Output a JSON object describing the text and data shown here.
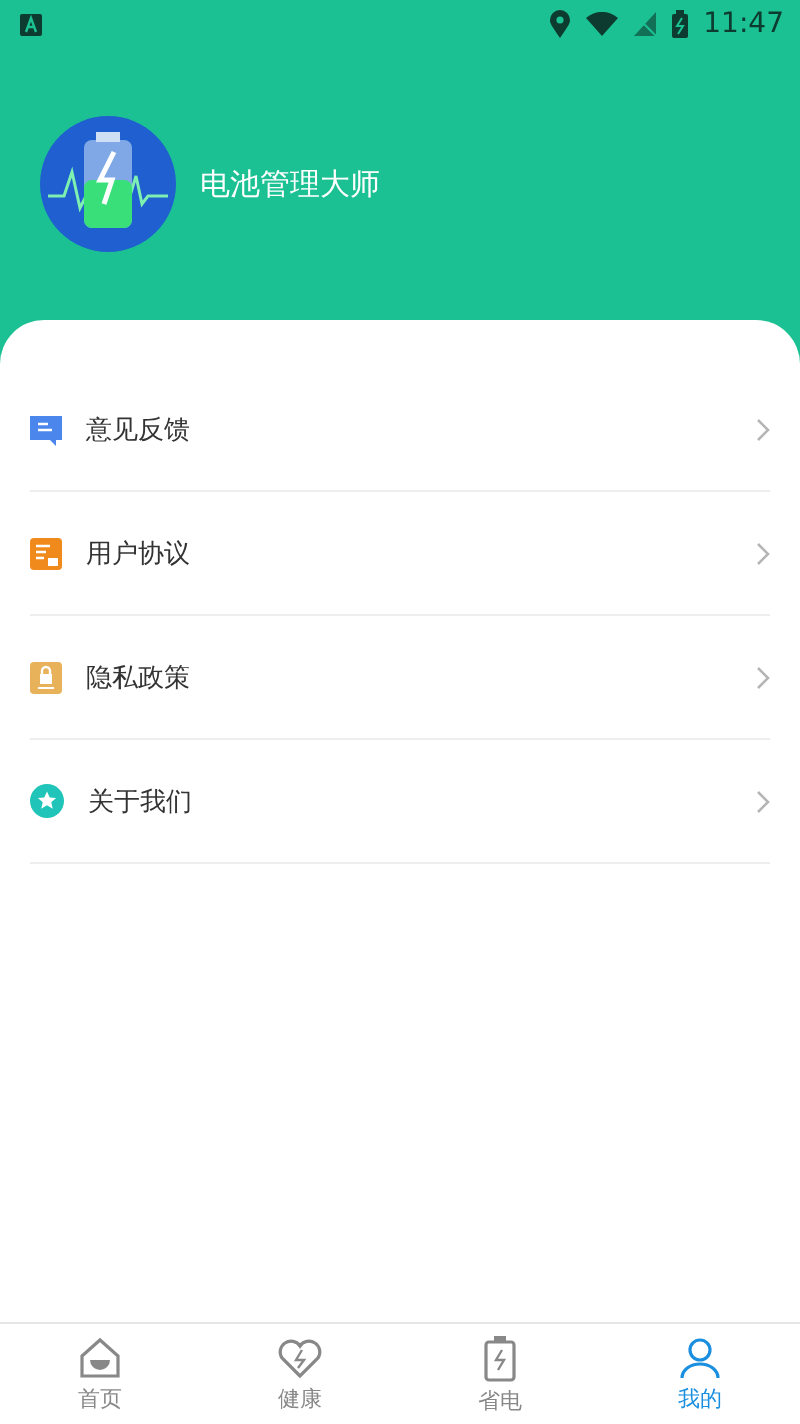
{
  "status_bar": {
    "time": "11:47"
  },
  "profile": {
    "app_name": "电池管理大师"
  },
  "menu": [
    {
      "kind": "feedback",
      "label": "意见反馈"
    },
    {
      "kind": "agreement",
      "label": "用户协议"
    },
    {
      "kind": "privacy",
      "label": "隐私政策"
    },
    {
      "kind": "about",
      "label": "关于我们"
    }
  ],
  "tabs": [
    {
      "kind": "home",
      "label": "首页",
      "selected": false
    },
    {
      "kind": "health",
      "label": "健康",
      "selected": false
    },
    {
      "kind": "power",
      "label": "省电",
      "selected": false
    },
    {
      "kind": "me",
      "label": "我的",
      "selected": true
    }
  ]
}
